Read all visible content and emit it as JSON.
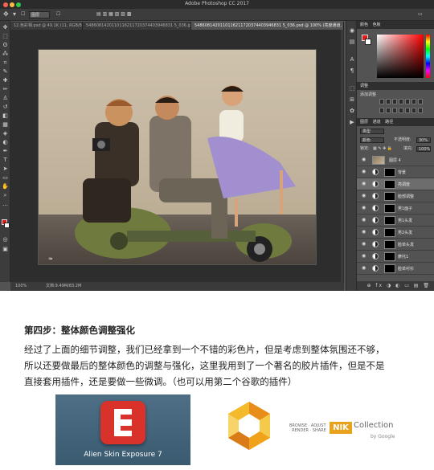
{
  "window": {
    "app_title": "Adobe Photoshop CC 2017",
    "traffic_colors": [
      "#fc605b",
      "#fdbc40",
      "#34c84a"
    ]
  },
  "options_bar": {
    "tool_icon": "move-tool-icon",
    "auto_select_value": "图层"
  },
  "document_tabs": [
    {
      "label": "12.色彩相.psd @ 49.1K (11, RGB/8#) ×",
      "active": false
    },
    {
      "label": "5486081420110116211720374403946831 5_036.jpg ×",
      "active": false
    },
    {
      "label": "5486081420110116211720374403946831 5_036.psd @ 100% (亮度通道, RGB/8#) ×",
      "active": true
    }
  ],
  "tools": [
    {
      "icon": "move-tool-icon",
      "glyph": "✥"
    },
    {
      "icon": "marquee-tool-icon",
      "glyph": "⬚"
    },
    {
      "icon": "lasso-tool-icon",
      "glyph": "ʘ"
    },
    {
      "icon": "quick-select-tool-icon",
      "glyph": "⁂"
    },
    {
      "icon": "crop-tool-icon",
      "glyph": "⌗"
    },
    {
      "icon": "eyedropper-tool-icon",
      "glyph": "✎"
    },
    {
      "icon": "healing-brush-icon",
      "glyph": "✚"
    },
    {
      "icon": "brush-tool-icon",
      "glyph": "✏"
    },
    {
      "icon": "clone-stamp-icon",
      "glyph": "♙"
    },
    {
      "icon": "history-brush-icon",
      "glyph": "↺"
    },
    {
      "icon": "eraser-tool-icon",
      "glyph": "◧"
    },
    {
      "icon": "gradient-tool-icon",
      "glyph": "▦"
    },
    {
      "icon": "blur-tool-icon",
      "glyph": "◈"
    },
    {
      "icon": "dodge-tool-icon",
      "glyph": "◐"
    },
    {
      "icon": "pen-tool-icon",
      "glyph": "✒"
    },
    {
      "icon": "type-tool-icon",
      "glyph": "T"
    },
    {
      "icon": "path-select-icon",
      "glyph": "➤"
    },
    {
      "icon": "shape-tool-icon",
      "glyph": "▭"
    },
    {
      "icon": "hand-tool-icon",
      "glyph": "✋"
    },
    {
      "icon": "zoom-tool-icon",
      "glyph": "⌕"
    },
    {
      "icon": "more-tools-icon",
      "glyph": "…"
    }
  ],
  "status_bar": {
    "zoom": "100%",
    "doc_size": "文档:9.49M/83.2M"
  },
  "panel_icons": [
    "color-panel-icon",
    "history-panel-icon",
    "character-panel-icon",
    "paragraph-panel-icon",
    "styles-panel-icon",
    "paths-panel-icon",
    "brush-panel-icon",
    "actions-panel-icon"
  ],
  "color_panel": {
    "tabs": [
      "颜色",
      "色板"
    ],
    "foreground": "#e11a1a",
    "background": "#ffffff"
  },
  "adjustments_panel": {
    "tabs": [
      "调整"
    ],
    "subtitle": "添加调整"
  },
  "layers_panel": {
    "tabs": [
      "图层",
      "通道",
      "路径"
    ],
    "filter_label": "类型",
    "blend_mode": "颜色",
    "opacity_label": "不透明度:",
    "opacity_value": "30%",
    "lock_label": "锁定:",
    "fill_label": "填充:",
    "fill_value": "100%",
    "layers": [
      {
        "name": "图层 4",
        "kind": "image",
        "selected": false
      },
      {
        "name": "背景",
        "kind": "adjustment",
        "selected": false
      },
      {
        "name": "亮调度",
        "kind": "adjustment",
        "selected": true
      },
      {
        "name": "脸部调整",
        "kind": "adjustment",
        "selected": false
      },
      {
        "name": "男1面子",
        "kind": "adjustment",
        "selected": false
      },
      {
        "name": "男1头发",
        "kind": "adjustment",
        "selected": false
      },
      {
        "name": "男2头发",
        "kind": "adjustment",
        "selected": false
      },
      {
        "name": "脸单头发",
        "kind": "adjustment",
        "selected": false
      },
      {
        "name": "摩托1",
        "kind": "adjustment",
        "selected": false
      },
      {
        "name": "脸单衬衫",
        "kind": "adjustment",
        "selected": false
      }
    ],
    "footer_icons": "⊕ fx ◑ ◐ ▭ ▤ 🗑"
  },
  "article": {
    "heading": "第四步：整体颜色调整强化",
    "paragraphs": [
      "经过了上面的细节调整，我们已经拿到一个不错的彩色片，但是考虑到整体氛围还不够，",
      "所以还要做最后的整体颜色的调整与强化，这里我用到了一个著名的胶片插件，但是不是",
      "直接套用插件，还是要做一些微调。（也可以用第二个谷歌的插件）"
    ]
  },
  "plugins": {
    "exposure_caption": "Alien Skin Exposure 7",
    "exposure_glyph": "E",
    "nik_brand_small_1": "BROWSE · ADJUST",
    "nik_brand_small_2": "· RENDER · SHARE",
    "nik_badge": "NIK",
    "nik_collection": "Collection",
    "nik_by": "by Google"
  }
}
